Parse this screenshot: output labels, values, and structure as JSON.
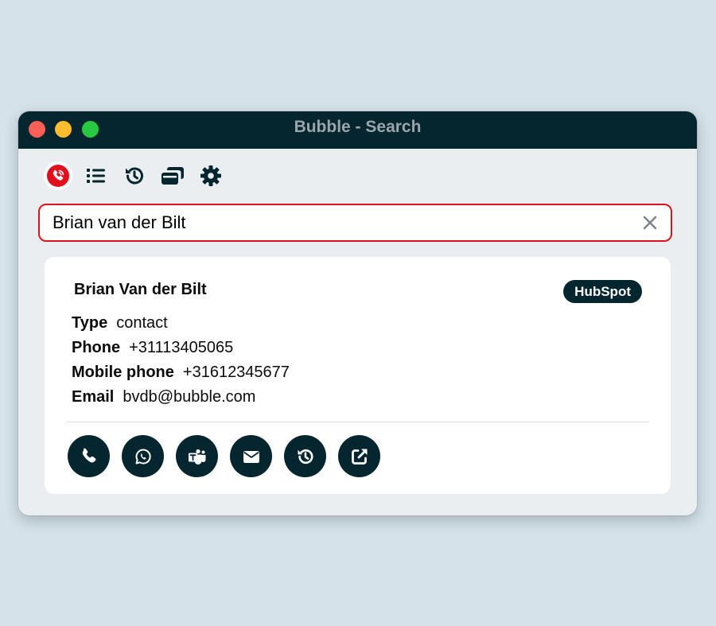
{
  "window": {
    "title": "Bubble - Search"
  },
  "toolbar": {
    "items": [
      {
        "icon": "phone-call-icon",
        "active": true
      },
      {
        "icon": "list-icon"
      },
      {
        "icon": "history-icon"
      },
      {
        "icon": "cards-icon"
      },
      {
        "icon": "gear-icon"
      }
    ]
  },
  "search": {
    "value": "Brian van der Bilt",
    "placeholder": ""
  },
  "result": {
    "name": "Brian Van der Bilt",
    "source_badge": "HubSpot",
    "fields": [
      {
        "label": "Type",
        "value": "contact"
      },
      {
        "label": "Phone",
        "value": "+31113405065"
      },
      {
        "label": "Mobile phone",
        "value": "+31612345677"
      },
      {
        "label": "Email",
        "value": "bvdb@bubble.com"
      }
    ],
    "actions": [
      {
        "icon": "phone-icon"
      },
      {
        "icon": "whatsapp-icon"
      },
      {
        "icon": "teams-icon"
      },
      {
        "icon": "envelope-icon"
      },
      {
        "icon": "history-icon"
      },
      {
        "icon": "external-link-icon"
      }
    ]
  },
  "colors": {
    "titlebar": "#05262e",
    "accent": "#05262e",
    "search_border": "#d9141c",
    "active_tool": "#e3101c",
    "background": "#d5e2ea"
  }
}
